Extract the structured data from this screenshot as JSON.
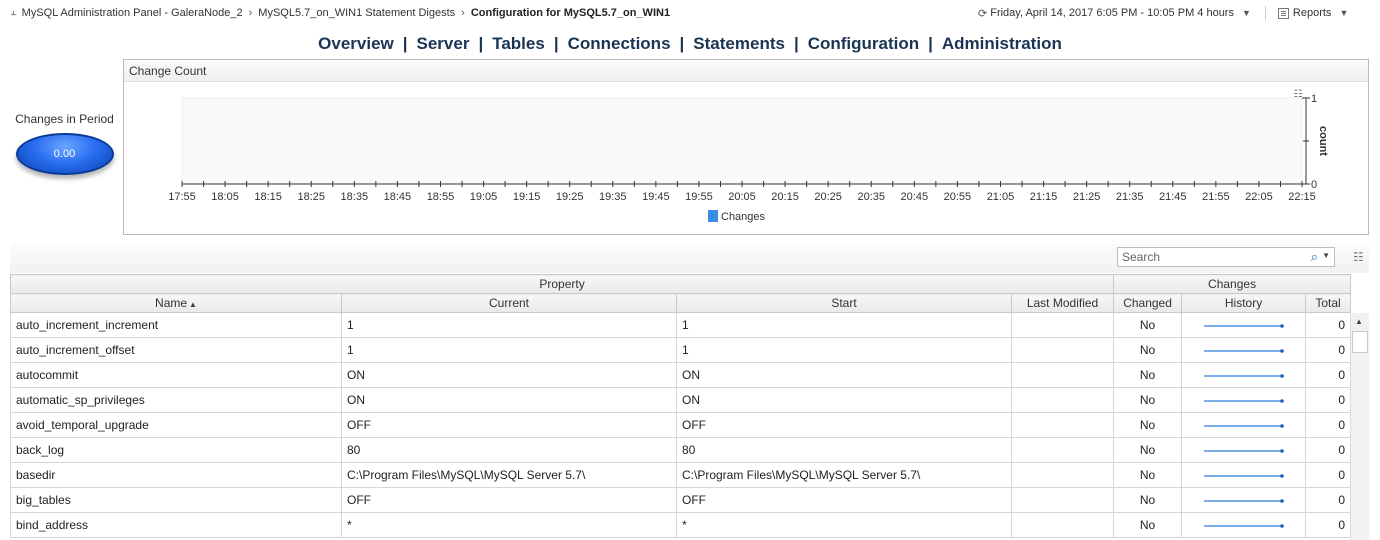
{
  "breadcrumb": {
    "items": [
      "MySQL Administration Panel - GaleraNode_2",
      "MySQL5.7_on_WIN1 Statement Digests",
      "Configuration for MySQL5.7_on_WIN1"
    ]
  },
  "timerange": {
    "label": "Friday, April 14, 2017 6:05 PM - 10:05 PM 4 hours"
  },
  "reports": {
    "label": "Reports"
  },
  "nav": {
    "items": [
      "Overview",
      "Server",
      "Tables",
      "Connections",
      "Statements",
      "Configuration",
      "Administration"
    ]
  },
  "gauge": {
    "label": "Changes in Period",
    "value": "0.00"
  },
  "chart_panel": {
    "title": "Change Count"
  },
  "chart_data": {
    "type": "line",
    "x": [
      "17:55",
      "18:05",
      "18:15",
      "18:25",
      "18:35",
      "18:45",
      "18:55",
      "19:05",
      "19:15",
      "19:25",
      "19:35",
      "19:45",
      "19:55",
      "20:05",
      "20:15",
      "20:25",
      "20:35",
      "20:45",
      "20:55",
      "21:05",
      "21:15",
      "21:25",
      "21:35",
      "21:45",
      "21:55",
      "22:05",
      "22:15"
    ],
    "series": [
      {
        "name": "Changes",
        "values": []
      }
    ],
    "ylabel": "count",
    "ylim": [
      0,
      1
    ],
    "yticks": [
      "0",
      "1"
    ],
    "legend": "bottom",
    "series_color": "#3a8ee6"
  },
  "search": {
    "placeholder": "Search"
  },
  "table": {
    "group_headers": {
      "property": "Property",
      "changes": "Changes"
    },
    "columns": {
      "name": "Name",
      "current": "Current",
      "start": "Start",
      "last_modified": "Last Modified",
      "changed": "Changed",
      "history": "History",
      "total": "Total"
    },
    "rows": [
      {
        "name": "auto_increment_increment",
        "current": "1",
        "start": "1",
        "last_modified": "",
        "changed": "No",
        "total": "0"
      },
      {
        "name": "auto_increment_offset",
        "current": "1",
        "start": "1",
        "last_modified": "",
        "changed": "No",
        "total": "0"
      },
      {
        "name": "autocommit",
        "current": "ON",
        "start": "ON",
        "last_modified": "",
        "changed": "No",
        "total": "0"
      },
      {
        "name": "automatic_sp_privileges",
        "current": "ON",
        "start": "ON",
        "last_modified": "",
        "changed": "No",
        "total": "0"
      },
      {
        "name": "avoid_temporal_upgrade",
        "current": "OFF",
        "start": "OFF",
        "last_modified": "",
        "changed": "No",
        "total": "0"
      },
      {
        "name": "back_log",
        "current": "80",
        "start": "80",
        "last_modified": "",
        "changed": "No",
        "total": "0"
      },
      {
        "name": "basedir",
        "current": "C:\\Program Files\\MySQL\\MySQL Server 5.7\\",
        "start": "C:\\Program Files\\MySQL\\MySQL Server 5.7\\",
        "last_modified": "",
        "changed": "No",
        "total": "0"
      },
      {
        "name": "big_tables",
        "current": "OFF",
        "start": "OFF",
        "last_modified": "",
        "changed": "No",
        "total": "0"
      },
      {
        "name": "bind_address",
        "current": "*",
        "start": "*",
        "last_modified": "",
        "changed": "No",
        "total": "0"
      }
    ]
  }
}
